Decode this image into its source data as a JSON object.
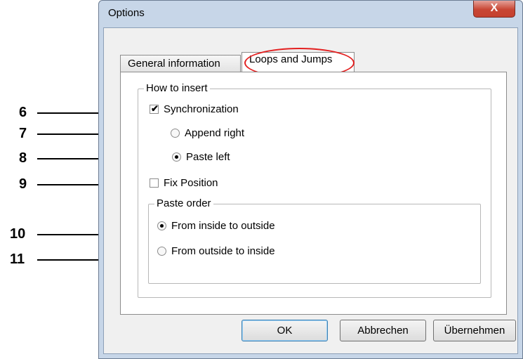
{
  "window": {
    "title": "Options",
    "close_glyph": "X"
  },
  "tabs": [
    {
      "label": "General information",
      "active": false
    },
    {
      "label": "Loops and Jumps",
      "active": true
    }
  ],
  "how_to_insert": {
    "legend": "How to insert",
    "synchronization": {
      "label": "Synchronization",
      "checked": true
    },
    "append_right": {
      "label": "Append right",
      "selected": false
    },
    "paste_left": {
      "label": "Paste left",
      "selected": true
    },
    "fix_position": {
      "label": "Fix Position",
      "checked": false
    }
  },
  "paste_order": {
    "legend": "Paste order",
    "inside_to_outside": {
      "label": "From inside to outside",
      "selected": true
    },
    "outside_to_inside": {
      "label": "From outside to inside",
      "selected": false
    }
  },
  "buttons": {
    "ok": "OK",
    "cancel": "Abbrechen",
    "apply": "Übernehmen"
  },
  "callouts": [
    "6",
    "7",
    "8",
    "9",
    "10",
    "11"
  ],
  "colors": {
    "highlight": "#e32020",
    "close_button": "#c84634",
    "frame": "#c7d6e8"
  }
}
